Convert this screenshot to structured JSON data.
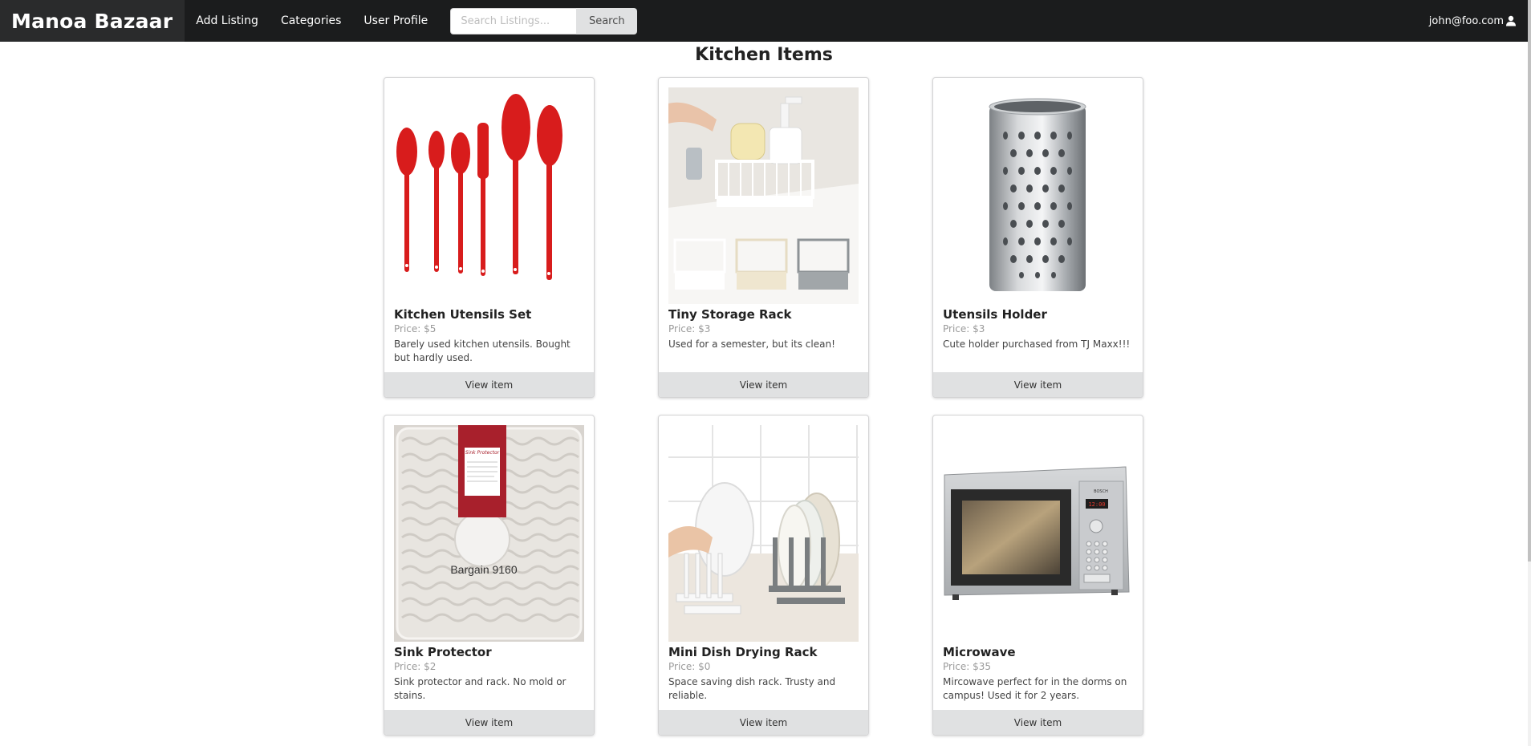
{
  "navbar": {
    "brand": "Manoa Bazaar",
    "links": [
      "Add Listing",
      "Categories",
      "User Profile"
    ],
    "search_placeholder": "Search Listings...",
    "search_button": "Search",
    "user_email": "john@foo.com",
    "user_icon": "user-icon"
  },
  "page": {
    "title": "Kitchen Items"
  },
  "items": [
    {
      "title": "Kitchen Utensils Set",
      "price": "Price: $5",
      "description": "Barely used kitchen utensils. Bought but hardly used.",
      "button": "View item"
    },
    {
      "title": "Tiny Storage Rack",
      "price": "Price: $3",
      "description": "Used for a semester, but its clean!",
      "button": "View item"
    },
    {
      "title": "Utensils Holder",
      "price": "Price: $3",
      "description": "Cute holder purchased from TJ Maxx!!!",
      "button": "View item"
    },
    {
      "title": "Sink Protector",
      "price": "Price: $2",
      "description": "Sink protector and rack. No mold or stains.",
      "button": "View item",
      "image_text": {
        "tag_label": "Sink Protector",
        "barcode": "Bargain 9160"
      }
    },
    {
      "title": "Mini Dish Drying Rack",
      "price": "Price: $0",
      "description": "Space saving dish rack. Trusty and reliable.",
      "button": "View item"
    },
    {
      "title": "Microwave",
      "price": "Price: $35",
      "description": "Mircowave perfect for in the dorms on campus! Used it for 2 years.",
      "button": "View item",
      "image_text": {
        "brand": "BOSCH",
        "display": "12:00"
      }
    }
  ]
}
